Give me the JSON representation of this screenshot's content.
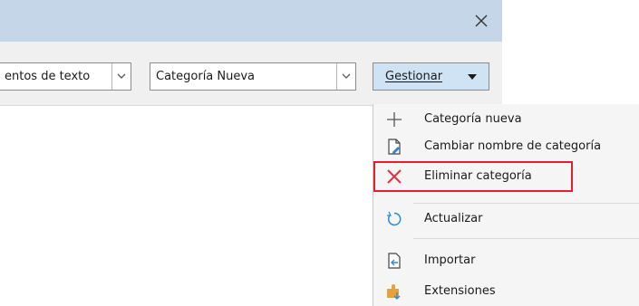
{
  "titlebar": {
    "close_icon": "close-icon"
  },
  "toolbar": {
    "filter_combo": {
      "value": "entos de texto"
    },
    "category_combo": {
      "value": "Categoría Nueva"
    },
    "manage_button": {
      "label": "Gestionar"
    }
  },
  "menu": {
    "items": [
      {
        "label": "Categoría nueva",
        "icon": "plus-icon"
      },
      {
        "label": "Cambiar nombre de categoría",
        "icon": "rename-document-icon"
      },
      {
        "label": "Eliminar categoría",
        "icon": "delete-x-icon",
        "highlighted": true
      },
      {
        "label": "Actualizar",
        "icon": "refresh-icon"
      },
      {
        "label": "Importar",
        "icon": "import-icon"
      },
      {
        "label": "Extensiones",
        "icon": "extensions-icon"
      }
    ]
  },
  "colors": {
    "titlebar": "#c5d6e9",
    "toolbar": "#f0f0f0",
    "manage_button": "#cfe3f5",
    "highlight_border": "#e0202f",
    "delete_icon": "#e03040",
    "refresh_icon": "#2e8bd6"
  }
}
